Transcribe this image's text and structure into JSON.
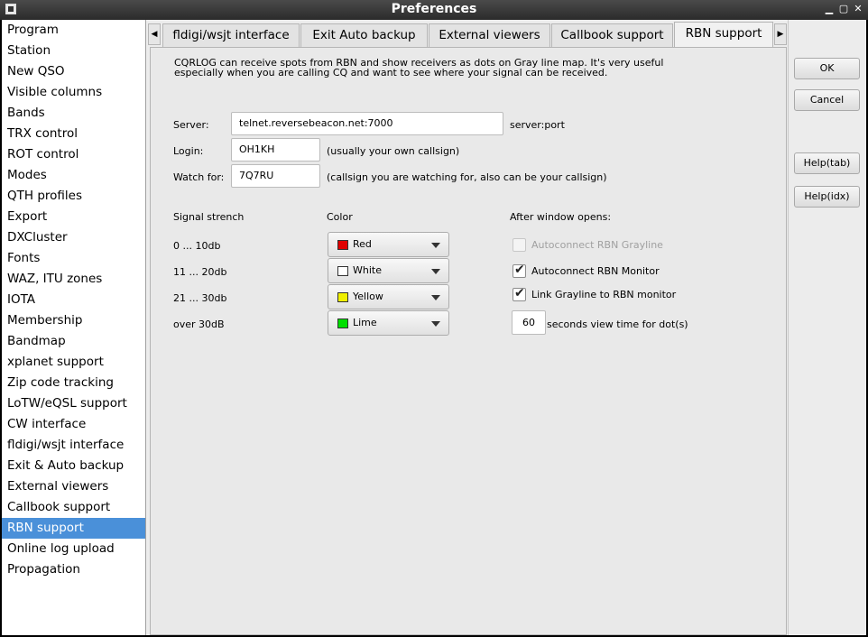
{
  "window": {
    "title": "Preferences"
  },
  "sidebar": {
    "selected_index": 25,
    "items": [
      {
        "label": "Program"
      },
      {
        "label": "Station"
      },
      {
        "label": "New QSO"
      },
      {
        "label": "Visible columns"
      },
      {
        "label": "Bands"
      },
      {
        "label": "TRX control"
      },
      {
        "label": "ROT control"
      },
      {
        "label": "Modes"
      },
      {
        "label": "QTH profiles"
      },
      {
        "label": "Export"
      },
      {
        "label": "DXCluster"
      },
      {
        "label": "Fonts"
      },
      {
        "label": "WAZ, ITU zones"
      },
      {
        "label": "IOTA"
      },
      {
        "label": "Membership"
      },
      {
        "label": "Bandmap"
      },
      {
        "label": "xplanet support"
      },
      {
        "label": "Zip code tracking"
      },
      {
        "label": "LoTW/eQSL support"
      },
      {
        "label": "CW interface"
      },
      {
        "label": "fldigi/wsjt interface"
      },
      {
        "label": "Exit & Auto backup"
      },
      {
        "label": "External viewers"
      },
      {
        "label": "Callbook support"
      },
      {
        "label": "RBN support"
      },
      {
        "label": "Online log upload"
      },
      {
        "label": "Propagation"
      }
    ]
  },
  "tabs": [
    {
      "label": "fldigi/wsjt interface"
    },
    {
      "label": "Exit  Auto backup"
    },
    {
      "label": "External viewers"
    },
    {
      "label": "Callbook support"
    },
    {
      "label": "RBN support",
      "active": true
    }
  ],
  "panel": {
    "intro_line1": "CQRLOG can receive spots from RBN and show receivers as dots on Gray line map. It's very useful",
    "intro_line2": "especially when you are calling CQ and want to see where your signal can be received.",
    "server_label": "Server:",
    "server_value": "telnet.reversebeacon.net:7000",
    "server_hint": "server:port",
    "login_label": "Login:",
    "login_value": "OH1KH",
    "login_hint": "(usually your own callsign)",
    "watch_label": "Watch for:",
    "watch_value": "7Q7RU",
    "watch_hint": "(callsign you are watching for, also can be your callsign)",
    "signal_header": "Signal strench",
    "color_header": "Color",
    "after_header": "After window opens:",
    "rows": [
      {
        "range": "0 ... 10db",
        "color_name": "Red",
        "color_hex": "#e00000"
      },
      {
        "range": "11 ... 20db",
        "color_name": "White",
        "color_hex": "#ffffff"
      },
      {
        "range": "21 ... 30db",
        "color_name": "Yellow",
        "color_hex": "#f0f000"
      },
      {
        "range": "over 30dB",
        "color_name": "Lime",
        "color_hex": "#00e000"
      }
    ],
    "opt_grayline": {
      "label": "Autoconnect RBN Grayline",
      "checked": false,
      "enabled": false
    },
    "opt_monitor": {
      "label": "Autoconnect RBN Monitor",
      "checked": true,
      "enabled": true
    },
    "opt_link": {
      "label": "Link Grayline to RBN monitor",
      "checked": true,
      "enabled": true
    },
    "view_time_value": "60",
    "view_time_label": "seconds view time for dot(s)"
  },
  "buttons": {
    "ok": "OK",
    "cancel": "Cancel",
    "help_tab": "Help(tab)",
    "help_idx": "Help(idx)"
  },
  "colors": {
    "selection": "#4a90d9",
    "titlebar": "#333333"
  },
  "icons": {
    "tab_scroll_left": "◀",
    "tab_scroll_right": "▶",
    "check_mark": "✔",
    "title_close": "✕",
    "title_minimize": "▁",
    "title_maximize": "▢"
  }
}
